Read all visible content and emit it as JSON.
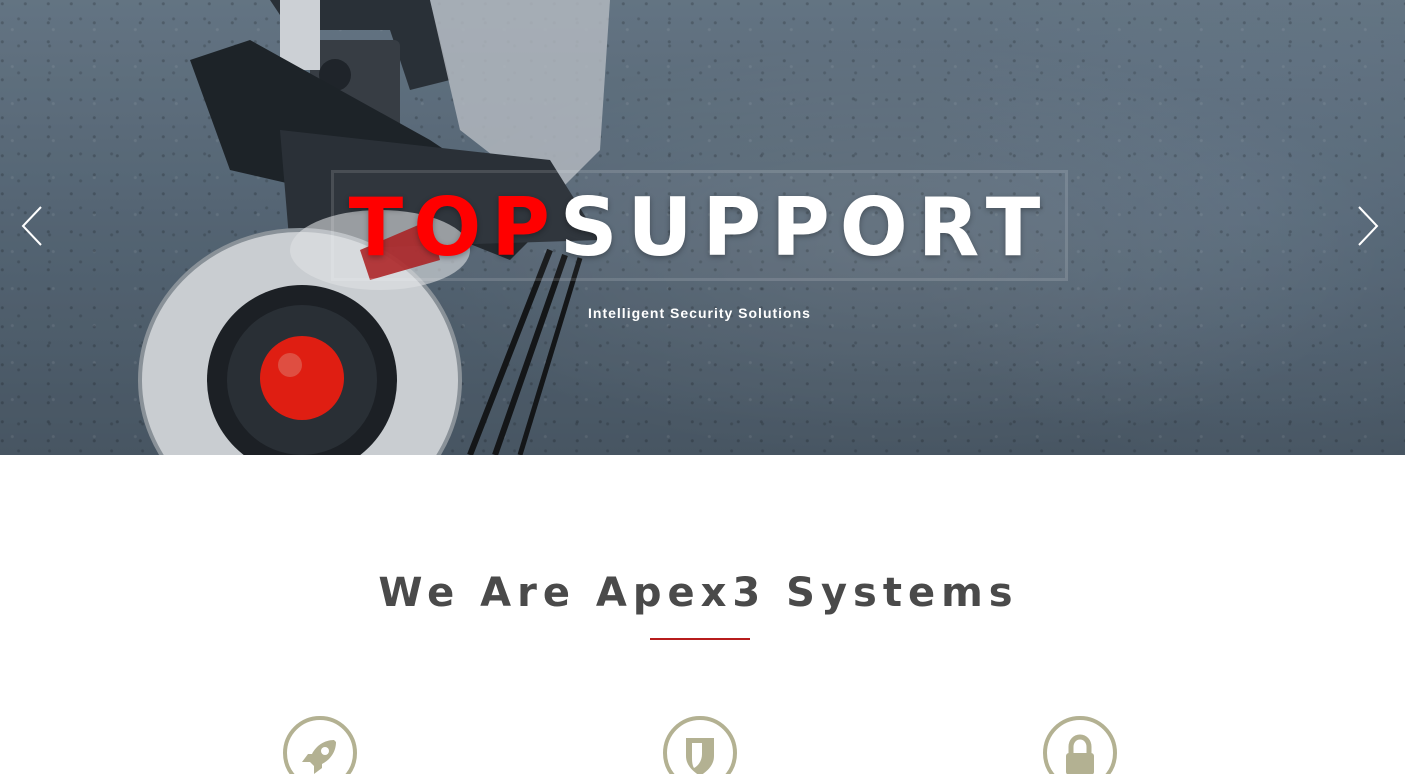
{
  "hero": {
    "title_red": "TOP",
    "title_white": "SUPPORT",
    "subtitle": "Intelligent Security Solutions",
    "prev_icon": "chevron-left-icon",
    "next_icon": "chevron-right-icon"
  },
  "about": {
    "title": "We Are Apex3 Systems",
    "features": [
      {
        "icon": "rocket-icon"
      },
      {
        "icon": "shield-icon"
      },
      {
        "icon": "lock-icon"
      }
    ]
  },
  "colors": {
    "accent_red": "#ff0000",
    "underline": "#b71c1c",
    "icon_olive": "#b3b192",
    "heading": "#4a4a4a"
  }
}
